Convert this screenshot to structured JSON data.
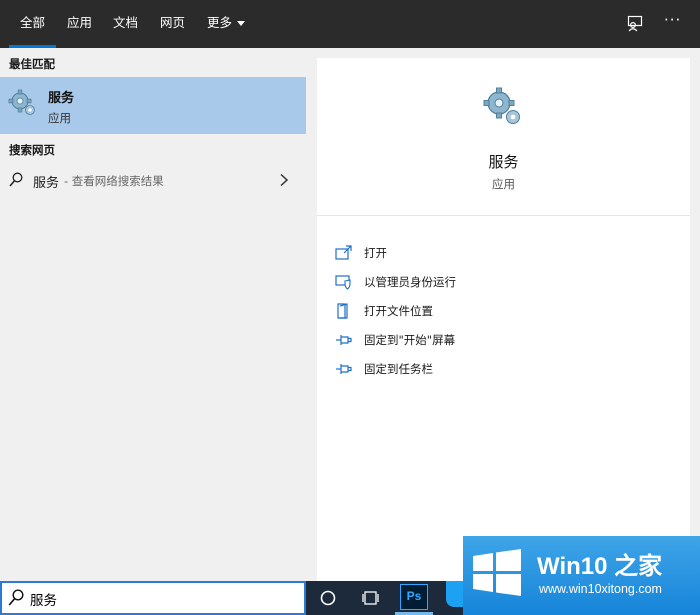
{
  "tabs": [
    {
      "label": "全部",
      "active": true
    },
    {
      "label": "应用",
      "active": false
    },
    {
      "label": "文档",
      "active": false
    },
    {
      "label": "网页",
      "active": false
    }
  ],
  "tab_more_label": "更多",
  "top_icons": [
    "feedback-icon",
    "more-options-icon"
  ],
  "top_more_glyph": "···",
  "left": {
    "best_match_header": "最佳匹配",
    "best_match": {
      "title": "服务",
      "subtitle": "应用",
      "icon": "gears-icon"
    },
    "search_web_header": "搜索网页",
    "web_result": {
      "term": "服务",
      "hint": "- 查看网络搜索结果"
    }
  },
  "detail": {
    "title": "服务",
    "subtitle": "应用",
    "actions": [
      {
        "label": "打开",
        "icon": "open-icon"
      },
      {
        "label": "以管理员身份运行",
        "icon": "run-as-admin-icon"
      },
      {
        "label": "打开文件位置",
        "icon": "file-location-icon"
      },
      {
        "label": "固定到\"开始\"屏幕",
        "icon": "pin-icon"
      },
      {
        "label": "固定到任务栏",
        "icon": "pin-icon"
      }
    ]
  },
  "search": {
    "value": "服务"
  },
  "taskbar": {
    "items": [
      "cortana-circle-icon",
      "task-view-icon",
      "photoshop-icon",
      "blue-app-icon"
    ],
    "ps_label": "Ps"
  },
  "watermark": {
    "brand": "Win10 之家",
    "url": "www.win10xitong.com"
  },
  "colors": {
    "topbar": "#2b2b2b",
    "accent": "#0078d7",
    "selection": "#a9c9ea",
    "pane": "#f0f0f0",
    "action_icon": "#1f6fc9",
    "taskbar": "#1c2a3c"
  }
}
